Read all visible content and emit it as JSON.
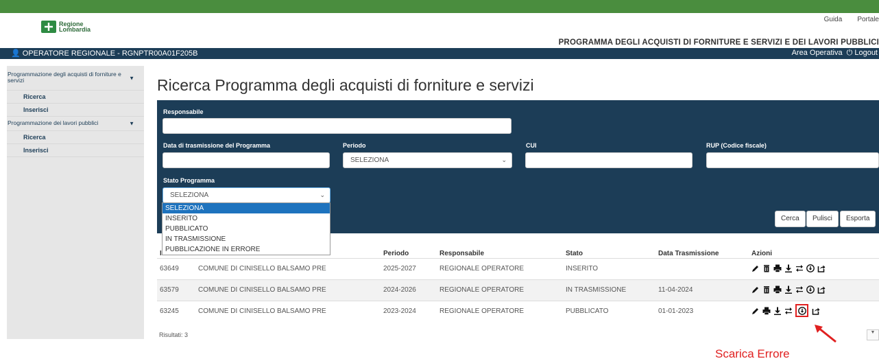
{
  "header": {
    "logo_text_1": "Regione",
    "logo_text_2": "Lombardia",
    "links": [
      "Guida",
      "Portale"
    ],
    "program_title": "PROGRAMMA DEGLI ACQUISTI DI FORNITURE E SERVIZI E DEI LAVORI PUBBLICI"
  },
  "userbar": {
    "user": "OPERATORE REGIONALE - RGNPTR00A01F205B",
    "area": "Area Operativa",
    "logout": "Logout"
  },
  "sidebar": {
    "sections": [
      {
        "label": "Programmazione degli acquisti di forniture e servizi",
        "items": [
          "Ricerca",
          "Inserisci"
        ]
      },
      {
        "label": "Programmazione dei lavori pubblici",
        "items": [
          "Ricerca",
          "Inserisci"
        ]
      }
    ]
  },
  "page_title": "Ricerca Programma degli acquisti di forniture e servizi",
  "form": {
    "responsabile_label": "Responsabile",
    "responsabile_value": "",
    "data_label": "Data di trasmissione del Programma",
    "data_value": "",
    "periodo_label": "Periodo",
    "periodo_value": "SELEZIONA",
    "cui_label": "CUI",
    "cui_value": "",
    "rup_label": "RUP (Codice fiscale)",
    "rup_value": "",
    "stato_label": "Stato Programma",
    "stato_value": "SELEZIONA",
    "stato_options": [
      "SELEZIONA",
      "INSERITO",
      "PUBBLICATO",
      "IN TRASMISSIONE",
      "PUBBLICAZIONE IN ERRORE"
    ],
    "buttons": {
      "search": "Cerca",
      "clear": "Pulisci",
      "export": "Esporta"
    }
  },
  "table": {
    "headers": {
      "id": "I",
      "periodo": "Periodo",
      "responsabile": "Responsabile",
      "stato": "Stato",
      "data": "Data Trasmissione",
      "azioni": "Azioni"
    },
    "rows": [
      {
        "id": "63649",
        "ente": "COMUNE DI CINISELLO BALSAMO PRE",
        "periodo": "2025-2027",
        "responsabile": "REGIONALE OPERATORE",
        "stato": "INSERITO",
        "data": ""
      },
      {
        "id": "63579",
        "ente": "COMUNE DI CINISELLO BALSAMO PRE",
        "periodo": "2024-2026",
        "responsabile": "REGIONALE OPERATORE",
        "stato": "IN TRASMISSIONE",
        "data": "11-04-2024"
      },
      {
        "id": "63245",
        "ente": "COMUNE DI CINISELLO BALSAMO PRE",
        "periodo": "2023-2024",
        "responsabile": "REGIONALE OPERATORE",
        "stato": "PUBBLICATO",
        "data": "01-01-2023"
      }
    ],
    "results": "Risultati: 3"
  },
  "annotation": {
    "text": "Scarica Errore",
    "color": "#e02020"
  },
  "colors": {
    "brand_green": "#4a8d3e",
    "navy": "#1c3d57",
    "select_blue": "#1e73be"
  }
}
